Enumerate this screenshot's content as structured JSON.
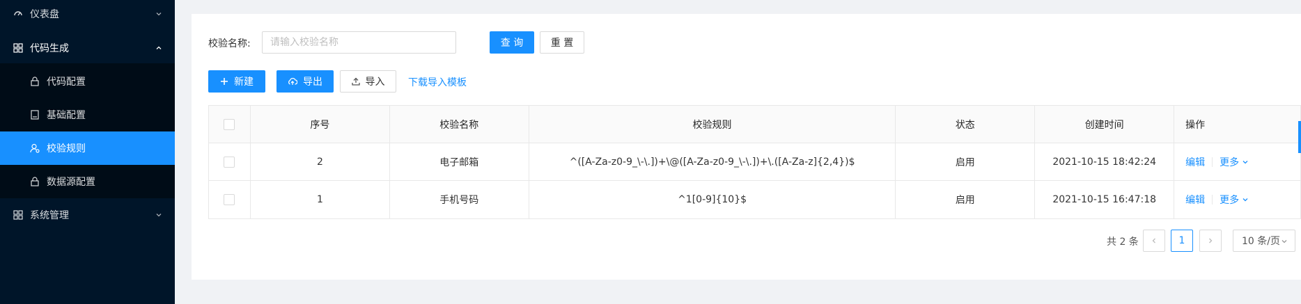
{
  "sidebar": {
    "items": [
      {
        "label": "仪表盘",
        "icon": "dashboard-icon",
        "level": "top",
        "state": "collapsed"
      },
      {
        "label": "代码生成",
        "icon": "app-grid-icon",
        "level": "top",
        "state": "expanded"
      },
      {
        "label": "代码配置",
        "icon": "lock-icon",
        "level": "sub"
      },
      {
        "label": "基础配置",
        "icon": "book-icon",
        "level": "sub"
      },
      {
        "label": "校验规则",
        "icon": "user-settings-icon",
        "level": "sub",
        "active": true
      },
      {
        "label": "数据源配置",
        "icon": "lock-icon",
        "level": "sub"
      },
      {
        "label": "系统管理",
        "icon": "app-grid-icon",
        "level": "top",
        "state": "collapsed"
      }
    ]
  },
  "search": {
    "label": "校验名称:",
    "placeholder": "请输入校验名称",
    "query_label": "查 询",
    "reset_label": "重 置"
  },
  "toolbar": {
    "new_label": "新建",
    "export_label": "导出",
    "import_label": "导入",
    "download_template_label": "下载导入模板"
  },
  "table": {
    "columns": [
      "序号",
      "校验名称",
      "校验规则",
      "状态",
      "创建时间",
      "操作"
    ],
    "rows": [
      {
        "index": "2",
        "name": "电子邮箱",
        "rule": "^([A-Za-z0-9_\\-\\.])+\\@([A-Za-z0-9_\\-\\.])+\\.([A-Za-z]{2,4})$",
        "status": "启用",
        "created": "2021-10-15 18:42:24"
      },
      {
        "index": "1",
        "name": "手机号码",
        "rule": "^1[0-9]{10}$",
        "status": "启用",
        "created": "2021-10-15 16:47:18"
      }
    ],
    "actions": {
      "edit": "编辑",
      "more": "更多"
    }
  },
  "pagination": {
    "total": "共 2 条",
    "current_page": "1",
    "page_size": "10 条/页"
  },
  "colors": {
    "sidebar_bg": "#001529",
    "submenu_bg": "#000c17",
    "primary": "#1890ff"
  }
}
